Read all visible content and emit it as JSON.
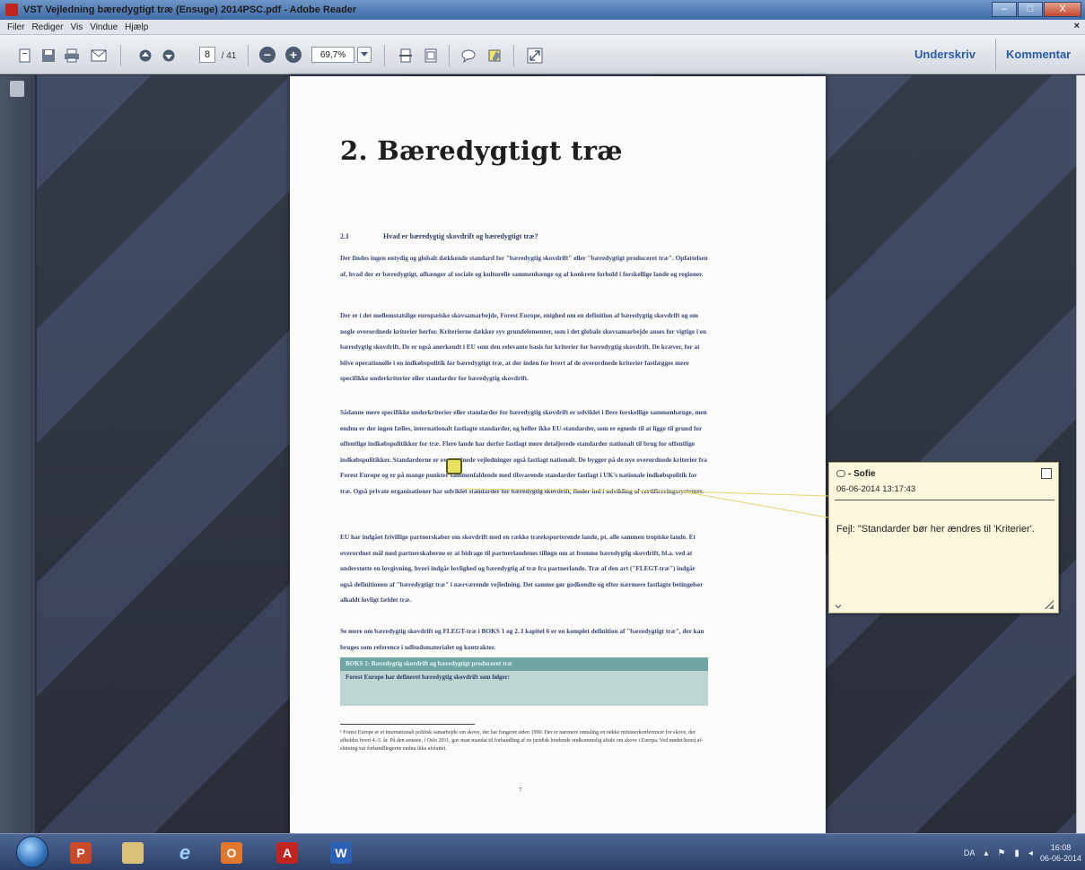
{
  "window": {
    "title": "VST Vejledning bæredygtigt træ (Ensuge) 2014PSC.pdf - Adobe Reader",
    "minimize": "–",
    "maximize": "□",
    "close": "X"
  },
  "menu": {
    "items": [
      "Filer",
      "Rediger",
      "Vis",
      "Vindue",
      "Hjælp"
    ],
    "close": "×"
  },
  "toolbar": {
    "page_current": "8",
    "page_total": "/ 41",
    "zoom": "69,7%",
    "zoom_out": "−",
    "zoom_in": "+",
    "sign_label": "Underskriv",
    "comment_label": "Kommentar"
  },
  "document": {
    "heading": "2. Bæredygtigt træ",
    "section_number": "2.1",
    "section_title": "Hvad er bæredygtig skovdrift og bæredygtigt træ?",
    "paragraphs": [
      "Der findes ingen entydig og globalt dækkende standard for \"bæredygtig skovdrift\" eller \"bæredygtigt produceret træ\". Opfattelsen af, hvad der er bæredygtigt, afhænger af sociale og kulturelle sammenhænge og af konkrete forhold i forskellige lande og regioner.",
      "Der er i det mellemstatslige europæiske skovsamarbejde, Forest Europe, enighed om en definition af bæredygtig skovdrift og om nogle overordnede kriterier herfor. Kriterierne dækker syv grundelementer, som i det globale skovsamarbejde anses for vigtige i en bæredygtig skovdrift. De er også anerkendt i EU som den relevante basis for kriterier for bæredygtig skovdrift. De kræver, for at blive operationelle i en indkøbspolitik for bæredygtigt træ, at der inden for hvert af de overordnede kriterier fastlægges mere specifikke underkriterier eller standarder for bæredygtig skovdrift.",
      "Sådanne mere specifikke underkriterier eller standarder for bæredygtig skovdrift er udviklet i flere forskellige sammenhænge, men endnu er der ingen fælles, internationalt fastlagte standarder, og heller ikke EU-standarder, som er egnede til at ligge til grund for offentlige indkøbspolitikker for træ. Flere lande har derfor fastlagt mere detaljerede standarder nationalt til brug for offentlige indkøbspolitikker. Standarderne er overordnede vejledninger også fastlagt nationalt. De bygger på de nye overordnede kriterier fra Forest Europe og er på mange punkter sammenfaldende med tilsvarende standarder fastlagt i UK's nationale indkøbspolitik for træ. Også private organisationer har udviklet standarder for bæredygtig skovdrift, finder ind i udvikling af certificeringssystemer.",
      "EU har indgået frivillige partnerskaber om skovdrift med en række træeksporterende lande, pt. alle sammen tropiske lande. Et overordnet mål med partnerskaberne er at bidrage til partnerlandenes tilløgn om at fremme bæredygtig skovdrift, bl.a. ved at understøtte en lovgivning, hvori indgår lovlighed og bæredygtig af træ fra partnerlande. Træ af den art (\"FLEGT-træ\") indgår også definitionen af \"bæredygtigt træ\" i nærværende vejledning. Det samme gør godkendte og efter nærmere fastlagte betingelser alkaldt lovligt fældet træ.",
      "Se mere om bæredygtig skovdrift og FLEGT-træ i BOKS 1 og 2. I kapitel 6 er en komplet definition af \"bæredygtigt træ\", der kan bruges som reference i udbudsmaterialet og kontrakter."
    ],
    "box_title": "BOKS 1: Bæredygtig skovdrift og bæredygtigt produceret træ",
    "box_text": "Forest Europe har defineret bæredygtig skovdrift som følger:",
    "footnote": "¹ Forest Europe er et internationalt politisk samarbejde om skove, der har fungeret siden 1990. Der er nærmere omtaling en række ministerkonferencer for skove, der afholdes hvert 4.-5. år. På den seneste, i Oslo 2011, gav man mandat til forhandling af en juridisk bindende ondkommelig aftale om skove i Europa. Ved mødet/konst af-slutning var forhandlingerne endnu ikke afsluttet.",
    "page_number": "7"
  },
  "comment": {
    "author": "Sofie",
    "author_prefix": "- ",
    "date": "06-06-2014 13:17:43",
    "text": "Fejl: \"Standarder bør her ændres til 'Kriterier'."
  },
  "taskbar": {
    "apps": [
      "start",
      "powerpoint",
      "explorer",
      "internet-explorer",
      "outlook",
      "adobe-reader",
      "word"
    ],
    "tray_lang": "DA",
    "clock_time": "16:08",
    "clock_date": "06-06-2014"
  }
}
